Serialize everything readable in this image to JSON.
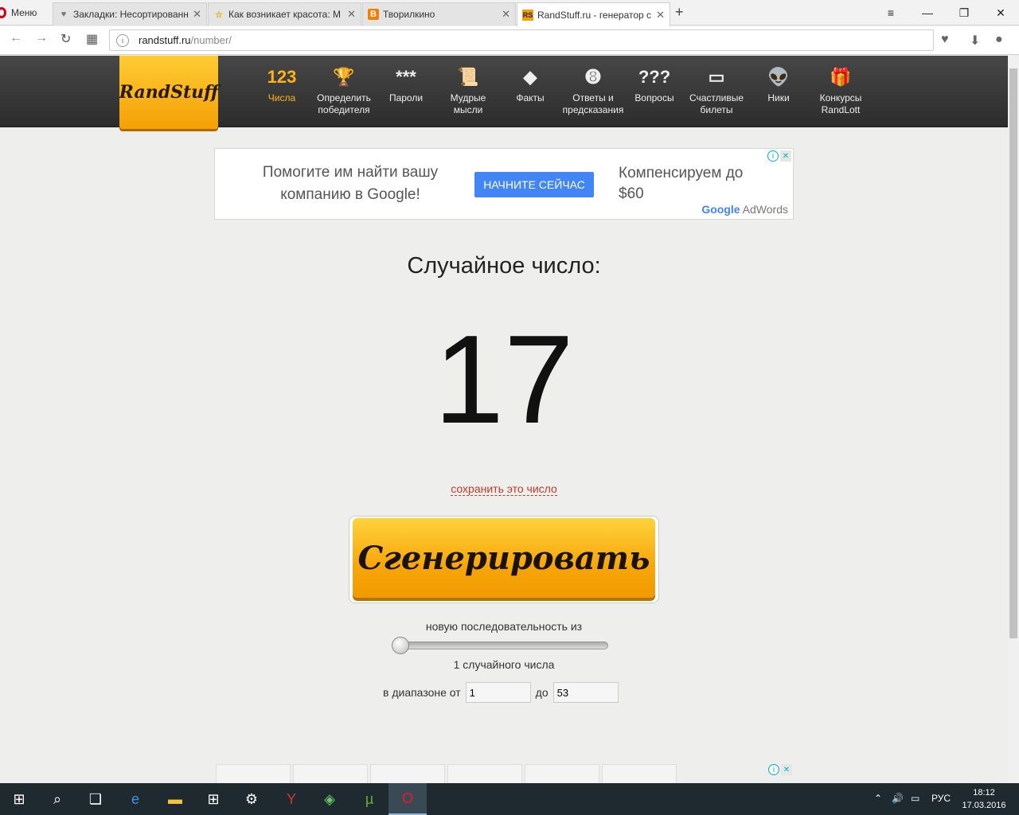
{
  "browser": {
    "menu_label": "Меню",
    "tabs": [
      {
        "title": "Закладки: Несортированные",
        "icon": "heart-icon"
      },
      {
        "title": "Как возникает красота: М",
        "icon": "star-icon"
      },
      {
        "title": "Творилкино",
        "icon": "blogger-icon"
      },
      {
        "title": "RandStuff.ru - генератор с",
        "icon": "randstuff-icon"
      }
    ],
    "url_host": "randstuff.ru",
    "url_path": "/number/"
  },
  "site": {
    "logo": "RandStuff",
    "nav": [
      {
        "label": "Числа",
        "icon": "123",
        "active": true
      },
      {
        "label": "Определить победителя",
        "icon": "trophy-icon"
      },
      {
        "label": "Пароли",
        "icon": "***"
      },
      {
        "label": "Мудрые мысли",
        "icon": "scroll-icon"
      },
      {
        "label": "Факты",
        "icon": "exclamation-icon"
      },
      {
        "label": "Ответы и предсказания",
        "icon": "eight-ball-icon"
      },
      {
        "label": "Вопросы",
        "icon": "???"
      },
      {
        "label": "Счастливые билеты",
        "icon": "ticket-icon"
      },
      {
        "label": "Ники",
        "icon": "alien-icon"
      },
      {
        "label": "Конкурсы RandLott",
        "icon": "gift-icon"
      }
    ]
  },
  "ad_top": {
    "text1": "Помогите им найти вашу компанию в Google!",
    "button": "НАЧНИТЕ СЕЙЧАС",
    "text2": "Компенсируем до $60",
    "brand_google": "Google",
    "brand_adwords": "AdWords"
  },
  "main": {
    "heading": "Случайное число:",
    "number": "17",
    "save_link": "сохранить это число",
    "generate_button": "Сгенерировать",
    "sequence_label": "новую последовательность из",
    "slider_value": 1,
    "count_label": "1 случайного числа",
    "range_from_label": "в диапазоне от",
    "range_from_value": "1",
    "range_to_label": "до",
    "range_to_value": "53"
  },
  "taskbar": {
    "lang": "РУС",
    "time": "18:12",
    "date": "17.03.2016"
  }
}
